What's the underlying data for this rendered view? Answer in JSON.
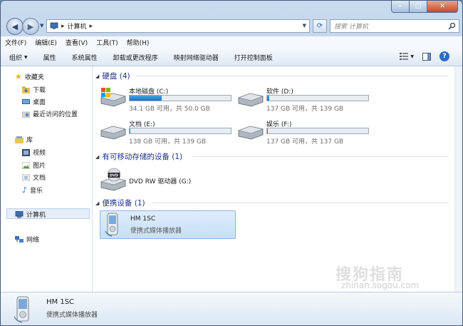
{
  "window": {
    "caption_minimize": "–",
    "caption_maximize": "□",
    "caption_close": "✕"
  },
  "nav": {
    "back_glyph": "◀",
    "forward_glyph": "▶",
    "address_path": "计算机",
    "address_sep": "▸",
    "search_placeholder": "搜索 计算机"
  },
  "menu": [
    {
      "label": "文件(F)"
    },
    {
      "label": "编辑(E)"
    },
    {
      "label": "查看(V)"
    },
    {
      "label": "工具(T)"
    },
    {
      "label": "帮助(H)"
    }
  ],
  "commands": {
    "organize": "组织",
    "properties": "属性",
    "system_properties": "系统属性",
    "uninstall": "卸载或更改程序",
    "map_drive": "映射网络驱动器",
    "control_panel": "打开控制面板",
    "help": "?"
  },
  "navpane": {
    "favorites": "收藏夹",
    "downloads": "下载",
    "desktop": "桌面",
    "recent": "最近访问的位置",
    "libraries": "库",
    "videos": "视频",
    "pictures": "图片",
    "documents": "文档",
    "music": "音乐",
    "computer": "计算机",
    "network": "网络"
  },
  "groups": {
    "hard_disks": "硬盘 (4)",
    "removable": "有可移动存储的设备 (1)",
    "portable": "便携设备 (1)"
  },
  "drives": [
    {
      "name": "本地磁盘 (C:)",
      "size": "34.1 GB 可用，共 50.0 GB",
      "used_pct": 32
    },
    {
      "name": "软件 (D:)",
      "size": "137 GB 可用，共 139 GB",
      "used_pct": 2
    },
    {
      "name": "文档 (E:)",
      "size": "138 GB 可用，共 139 GB",
      "used_pct": 1
    },
    {
      "name": "娱乐 (F:)",
      "size": "137 GB 可用，共 137 GB",
      "used_pct": 0.5
    }
  ],
  "dvd": {
    "name": "DVD RW 驱动器 (G:)",
    "badge": "DVD"
  },
  "device": {
    "name": "HM 1SC",
    "type": "便携式媒体播放器"
  },
  "details": {
    "name": "HM 1SC",
    "type": "便携式媒体播放器"
  },
  "watermark": {
    "main": "搜狗指南",
    "sub": "zhinan.sogou.com"
  }
}
